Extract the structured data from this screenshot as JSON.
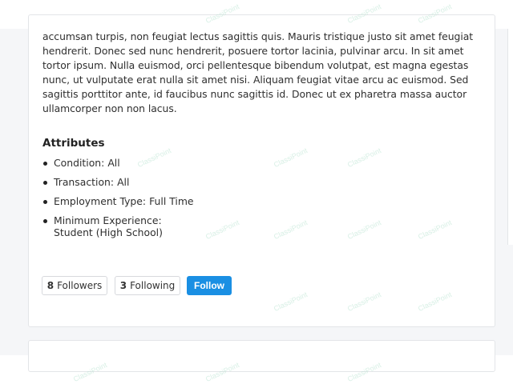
{
  "listing": {
    "description": "accumsan turpis, non feugiat lectus sagittis quis. Mauris tristique justo sit amet feugiat hendrerit. Donec sed nunc hendrerit, posuere tortor lacinia, pulvinar arcu. In sit amet tortor ipsum. Nulla euismod, orci pellentesque bibendum volutpat, est magna egestas nunc, ut vulputate erat nulla sit amet nisi. Aliquam feugiat vitae arcu ac euismod. Sed sagittis porttitor ante, id faucibus nunc sagittis id. Donec ut ex pharetra massa auctor ullamcorper non non lacus."
  },
  "attributes": {
    "title": "Attributes",
    "items": [
      {
        "label": "Condition:",
        "value": "All"
      },
      {
        "label": "Transaction:",
        "value": "All"
      },
      {
        "label": "Employment Type:",
        "value": "Full Time"
      },
      {
        "label": "Minimum Experience:",
        "value": "Student (High School)"
      }
    ]
  },
  "social": {
    "followers_count": "8",
    "followers_label": "Followers",
    "following_count": "3",
    "following_label": "Following",
    "follow_label": "Follow"
  },
  "watermark": {
    "text": "ClassiPoint"
  },
  "colors": {
    "accent": "#1a8fe3",
    "watermark": "#b8e3d0"
  }
}
